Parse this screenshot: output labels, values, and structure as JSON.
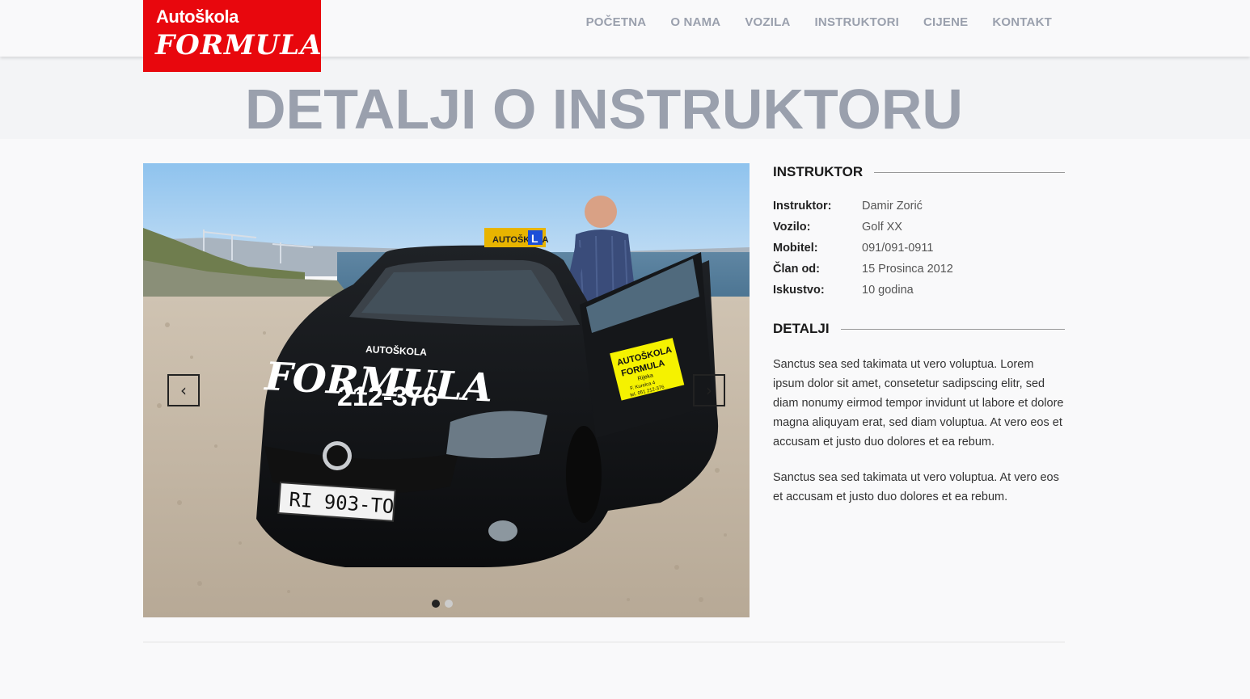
{
  "brand": {
    "top": "Autoškola",
    "main": "FORMULA",
    "color": "#e8070d"
  },
  "nav": [
    {
      "label": "POČETNA"
    },
    {
      "label": "O NAMA"
    },
    {
      "label": "VOZILA"
    },
    {
      "label": "INSTRUKTORI"
    },
    {
      "label": "CIJENE"
    },
    {
      "label": "KONTAKT"
    }
  ],
  "page": {
    "title": "DETALJI O INSTRUKTORU"
  },
  "slider": {
    "prev_icon": "chevron-left-icon",
    "next_icon": "chevron-right-icon",
    "prev_glyph": "‹",
    "next_glyph": "›",
    "photo": {
      "roof_sign": "AUTOŠKOLA",
      "roof_l": "L",
      "hood_brand": "AUTOŠKOLA",
      "hood_name": "FORMULA",
      "hood_phone": "212-376",
      "plate": "RI 903-TO",
      "door_sign_line1": "AUTOŠKOLA",
      "door_sign_line2": "FORMULA",
      "door_sign_line3": "Rijeka",
      "door_sign_line4": "F. Kurelca 4",
      "door_sign_line5": "tel. 051 212-376"
    },
    "slide_count": 2,
    "active_slide": 1
  },
  "instructor": {
    "heading": "INSTRUKTOR",
    "rows": [
      {
        "label": "Instruktor:",
        "value": "Damir Zorić"
      },
      {
        "label": "Vozilo:",
        "value": "Golf XX"
      },
      {
        "label": "Mobitel:",
        "value": "091/091-0911"
      },
      {
        "label": "Član od:",
        "value": "15 Prosinca 2012"
      },
      {
        "label": "Iskustvo:",
        "value": "10 godina"
      }
    ]
  },
  "details": {
    "heading": "DETALJI",
    "paragraphs": [
      "Sanctus sea sed takimata ut vero voluptua. Lorem ipsum dolor sit amet, consetetur sadipscing elitr, sed diam nonumy eirmod tempor invidunt ut labore et dolore magna aliquyam erat, sed diam voluptua. At vero eos et accusam et justo duo dolores et ea rebum.",
      "Sanctus sea sed takimata ut vero voluptua. At vero eos et accusam et justo duo dolores et ea rebum."
    ]
  }
}
